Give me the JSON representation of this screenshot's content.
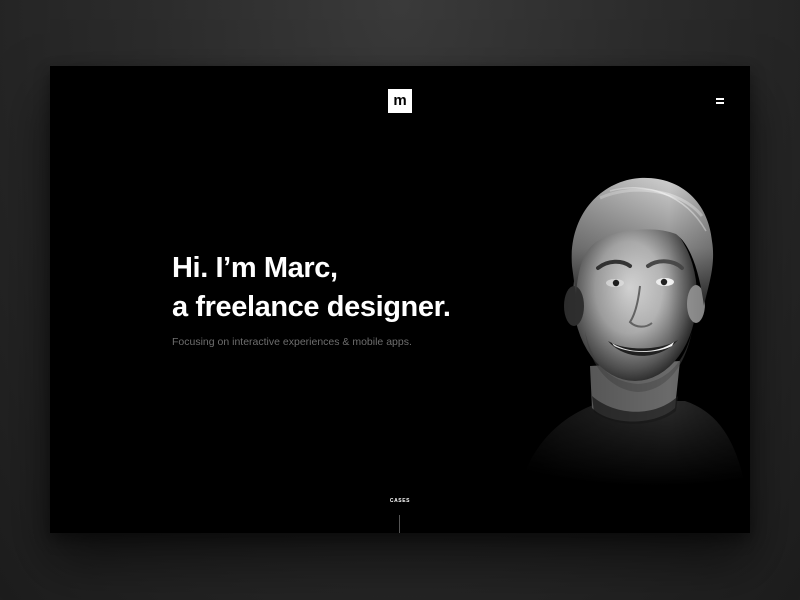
{
  "header": {
    "logo_letter": "m",
    "menu_icon": "hamburger-menu-icon"
  },
  "hero": {
    "line1": "Hi. I’m Marc,",
    "line2": "a freelance designer.",
    "tagline": "Focusing on interactive experiences & mobile apps."
  },
  "footer": {
    "cases_label": "CASES"
  },
  "colors": {
    "page_background": "#2b2b2b",
    "frame_background": "#000000",
    "text_primary": "#ffffff",
    "text_muted": "#6e6e6e"
  }
}
